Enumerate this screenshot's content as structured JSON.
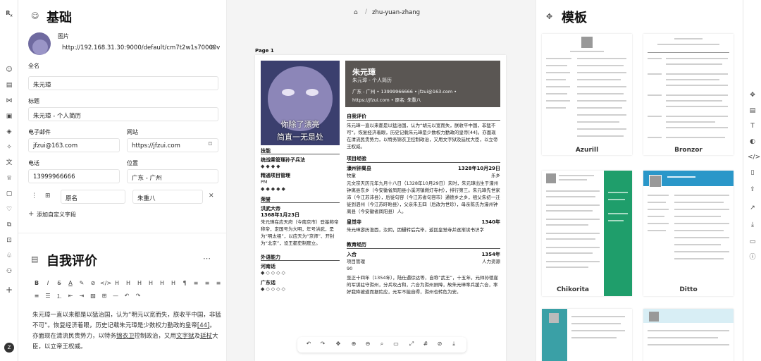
{
  "left_panel": {
    "basics_title": "基础",
    "picture_label": "图片",
    "picture_url": "http://192.168.31.30:9000/default/cm7t2w1s70000v",
    "fullname_label": "全名",
    "fullname_value": "朱元璋",
    "headline_label": "标题",
    "headline_value": "朱元璋 - 个人简历",
    "email_label": "电子邮件",
    "email_value": "jfzui@163.com",
    "website_label": "网站",
    "website_value": "https://jfzui.com",
    "phone_label": "电话",
    "phone_value": "13999966666",
    "location_label": "位置",
    "location_value": "广东 - 广州",
    "custom_field_name": "原名",
    "custom_field_value": "朱重八",
    "add_custom_field": "添加自定义字段",
    "summary_title": "自我评价",
    "summary_text_1": "朱元璋一直以来都是以猛治国，认为“明元以宽而失，朕收平中国，非猛不可”。恢复经济着眼，历史记载朱元璋是少数权力勤政的皇帝",
    "summary_link": "[44]",
    "summary_text_2": "。亦面现在清流民贵势力，以特务",
    "summary_u1": "锦衣卫",
    "summary_text_3": "控制政治，又用",
    "summary_u2": "文字狱",
    "summary_text_4": "及",
    "summary_u3": "廷杖",
    "summary_text_5": "大臣，以立帝王权威。"
  },
  "center": {
    "breadcrumb": "zhu-yuan-zhang",
    "page_label": "Page 1",
    "resume": {
      "name": "朱元璋",
      "headline": "朱元璋 - 个人简历",
      "contact_line": "广东 - 广州 • 13999966666 • jfzui@163.com •",
      "contact_line2": "https://jfzui.com • 原名: 朱重八",
      "caption_1": "你除了漂亮",
      "caption_2": "简直一无是处",
      "skills_title": "技能",
      "skill1": "统战乘管理孙子兵法",
      "skill2": "精通项目管理",
      "skill2_sub": "PM",
      "awards_title": "荣誉",
      "award1": "洪武大帝",
      "award1_date": "1368年1月23日",
      "award1_desc": "朱元璋在应天府（今南京市）登基称帝称帝，定国号为大明，年号洪武，是为“明太祖”，以应天为“京师”、开封为“北京”，设王都史制度立。",
      "langs_title": "外语能力",
      "lang1": "河南话",
      "lang2": "广东话",
      "summary_title": "自我评价",
      "summary": "朱元璋一直以来都是以猛治国，认为“胡元以宽而失，朕收平中国，非猛不可”。恢复经济着眼，历史记载朱元璋是少数权力勤政的皇帝[44]。亦面现在清流民贵势力，以特务锦衣卫控制政治，又用文字狱及廷杖大臣，以立帝王权威。",
      "exp_title": "项目经验",
      "exp1": "濠州钟离县",
      "exp1_date": "1328年10月29日",
      "exp1_role": "牧童",
      "exp1_place": "乐乡",
      "exp1_desc": "元文宗天历元年九月十八日（1328年10月29日）未时，朱元璋出生于濠州钟离县东乡（今安徽省凤阳县小溪河镇燃灯寺村），排行第三。朱元璋先世家沛（今江苏沛县），后徙句容（今江苏省句容市）通德乡之乡，祖父朱初一迁徙到泗州（今江苏盱眙县），父亲朱五四（后改为世珍），母亲陈氏为濠州钟离县（今安徽省凤阳县）人。",
      "exp2": "皇觉寺",
      "exp2_date": "1340年",
      "exp2_desc": "朱元璋游历淮西，汝阴，因辗转后完毕，返回皇觉寺并逐渐读书识字",
      "edu_title": "教育经历",
      "edu1": "入合",
      "edu1_date": "1354年",
      "edu1_sub": "项目管理",
      "edu1_right": "人力资源",
      "edu1_score": "90",
      "edu1_desc": "至正十四年（1354年），陆仕遇徐达等，自称“武王”，十五年，元帅孙德崖的军谋驻守滁州，分兵攻占和，六合为滁州屏障，故朱元璋率兵援六合，率好我降被道而据险应，元军不能自得，滁州也转危为安。"
    },
    "toolbar_icons": [
      "undo-icon",
      "redo-icon",
      "pan-icon",
      "zoom-in-icon",
      "zoom-out-icon",
      "fit-icon",
      "toggle-layout-icon",
      "fullscreen-icon",
      "hash-icon",
      "link-icon",
      "download-icon"
    ]
  },
  "right_panel": {
    "templates_title": "模板",
    "templates": [
      "Azurill",
      "Bronzor",
      "Chikorita",
      "Ditto"
    ]
  },
  "colors": {
    "header_bg": "#5a5653",
    "chikorita_green": "#1f9e6b",
    "ditto_teal": "#2a97c9",
    "accent": "#111111"
  }
}
